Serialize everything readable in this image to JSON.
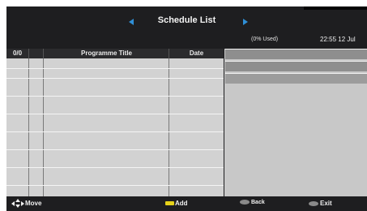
{
  "header": {
    "title": "Schedule List",
    "prev_icon": "triangle-left-icon",
    "next_icon": "triangle-right-icon",
    "used": "(0% Used)",
    "clock": "22:55 12 Jul"
  },
  "table": {
    "headers": {
      "count": "0/0",
      "title": "Programme Title",
      "date": "Date"
    },
    "rows": []
  },
  "footer": {
    "move": {
      "icon": "four-way-arrows-icon",
      "label": "Move"
    },
    "add": {
      "icon": "yellow-key-icon",
      "label": "Add"
    },
    "back": {
      "icon": "grey-oval-key-icon",
      "label": "Back"
    },
    "exit": {
      "icon": "grey-oval-key-icon",
      "label": "Exit"
    }
  },
  "colors": {
    "background": "#1e1e20",
    "accent_arrow": "#2f8fd6",
    "list_row": "#d2d2d2",
    "yellow_key": "#e6d21a"
  }
}
